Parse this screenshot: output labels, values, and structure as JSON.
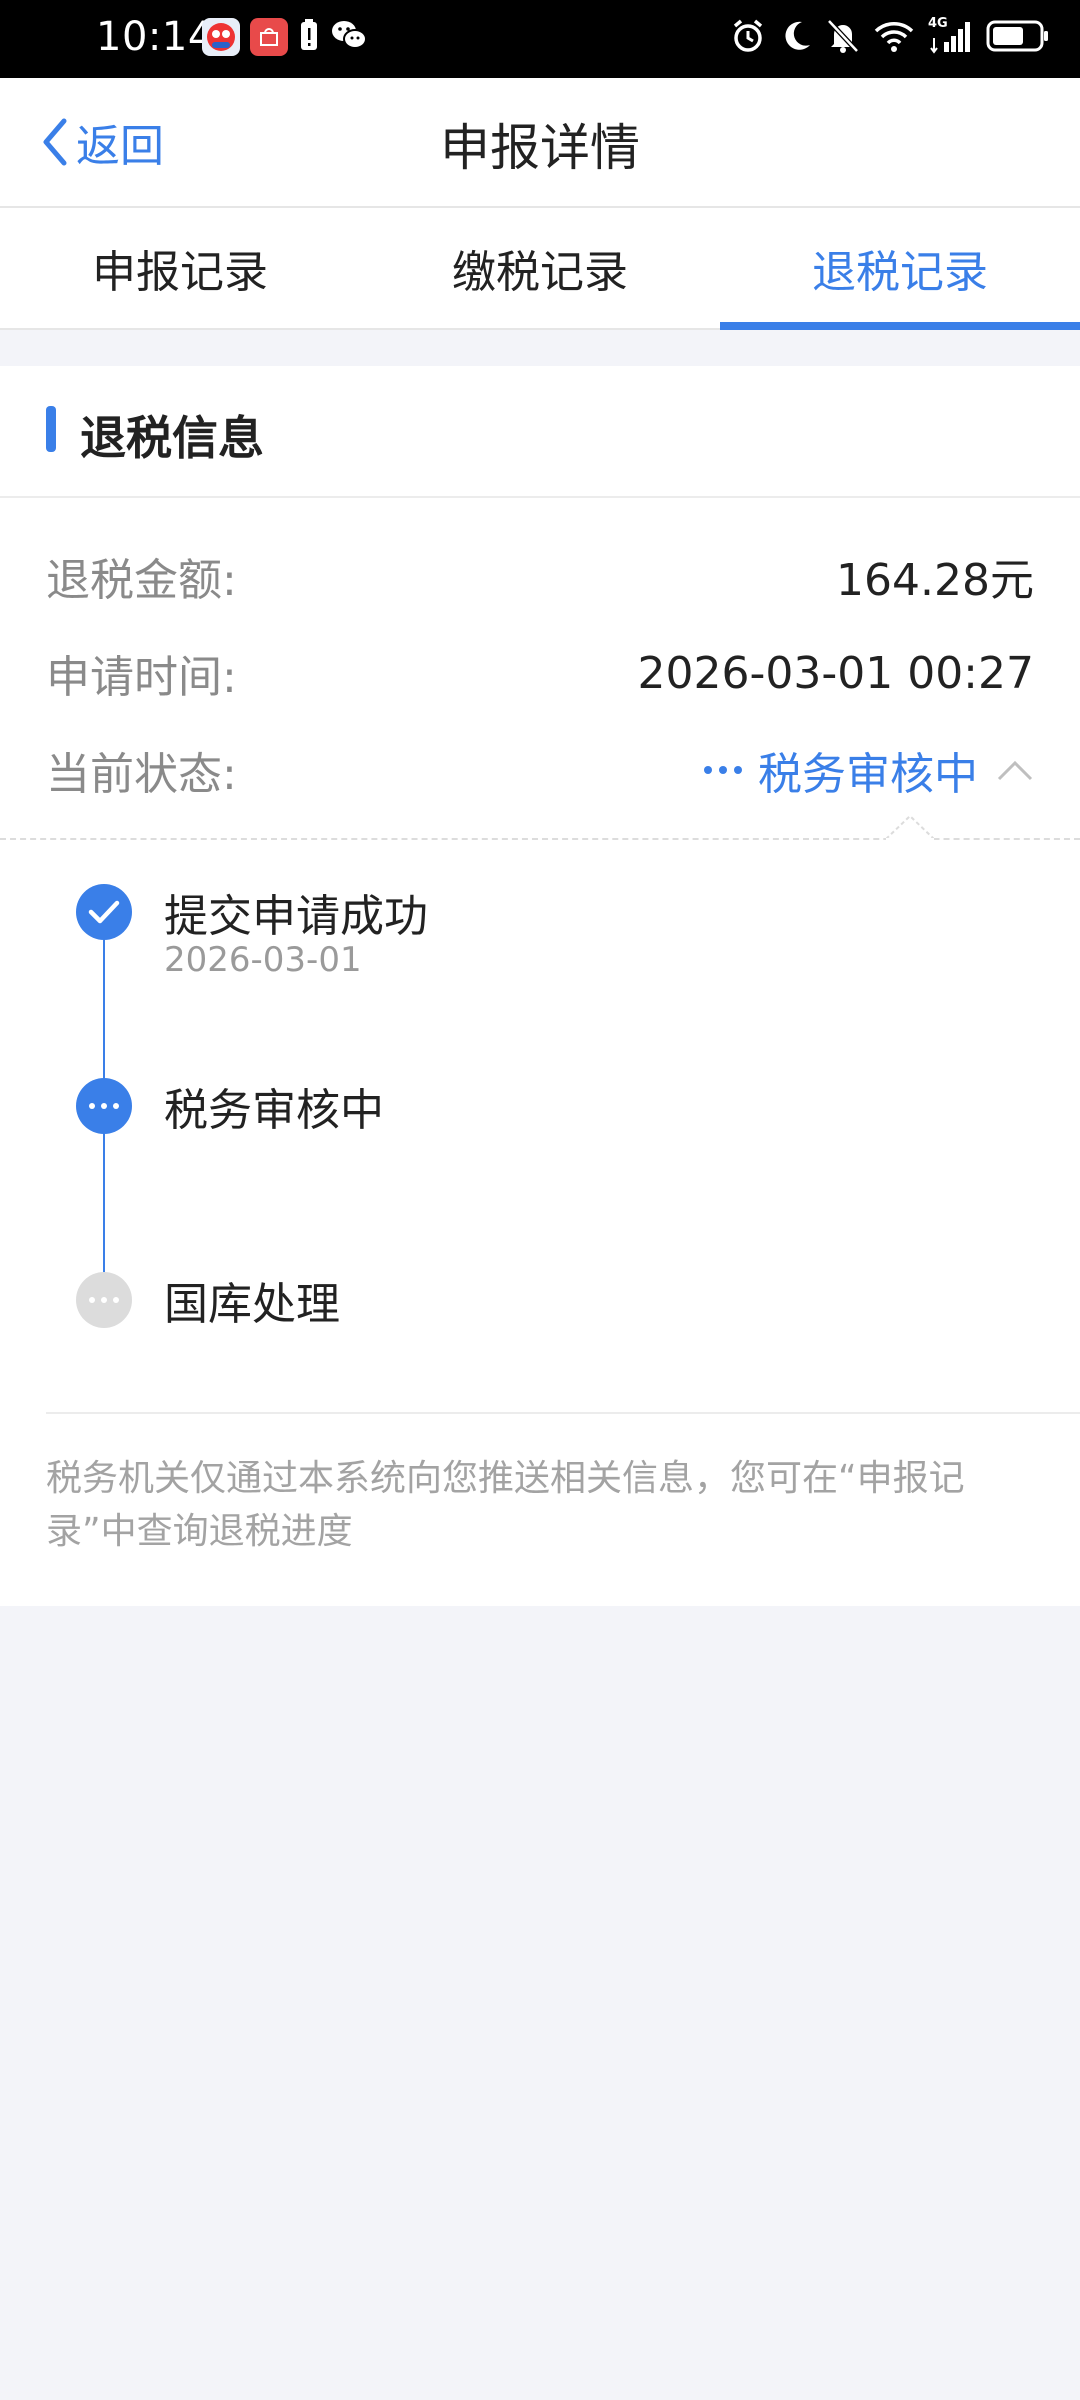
{
  "status_bar": {
    "time": "10:14",
    "network": "4G",
    "icons": [
      "app-icon",
      "huawei-store-icon",
      "battery-alert-icon",
      "wechat-icon",
      "alarm-icon",
      "moon-icon",
      "bell-off-icon",
      "wifi-icon",
      "signal-icon",
      "battery-icon"
    ]
  },
  "nav": {
    "back_label": "返回",
    "title": "申报详情"
  },
  "tabs": [
    {
      "label": "申报记录",
      "active": false
    },
    {
      "label": "缴税记录",
      "active": false
    },
    {
      "label": "退税记录",
      "active": true
    }
  ],
  "section": {
    "title": "退税信息"
  },
  "info": {
    "amount_label": "退税金额:",
    "amount_value": "164.28元",
    "time_label": "申请时间:",
    "time_value": "2026-03-01 00:27",
    "status_label": "当前状态:",
    "status_value": "税务审核中"
  },
  "timeline": [
    {
      "title": "提交申请成功",
      "date": "2026-03-01",
      "state": "done"
    },
    {
      "title": "税务审核中",
      "date": "",
      "state": "current"
    },
    {
      "title": "国库处理",
      "date": "",
      "state": "pending"
    }
  ],
  "note": "税务机关仅通过本系统向您推送相关信息，您可在“申报记录”中查询退税进度",
  "colors": {
    "accent": "#3a7fe8",
    "background": "#f3f4f9",
    "pending_node": "#dcdcdc"
  }
}
